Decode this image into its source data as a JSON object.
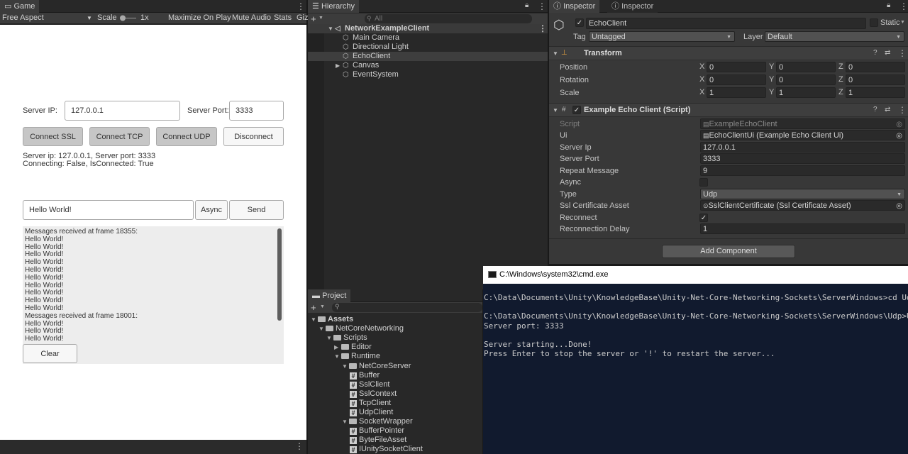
{
  "game": {
    "tab": "Game",
    "toolbar": {
      "aspect": "Free Aspect",
      "scale_label": "Scale",
      "scale_value": "1x",
      "maximize": "Maximize On Play",
      "mute": "Mute Audio",
      "stats": "Stats",
      "gizmos": "Giz"
    },
    "server_ip_label": "Server IP:",
    "server_ip_value": "127.0.0.1",
    "server_port_label": "Server Port:",
    "server_port_value": "3333",
    "buttons": {
      "connect_ssl": "Connect SSL",
      "connect_tcp": "Connect TCP",
      "connect_udp": "Connect UDP",
      "disconnect": "Disconnect",
      "async": "Async",
      "send": "Send",
      "clear": "Clear"
    },
    "status_line1": "Server ip: 127.0.0.1, Server port: 3333",
    "status_line2": "Connecting: False, IsConnected: True",
    "message_input": "Hello World!",
    "log": [
      "Messages received at frame 18355:",
      "Hello World!",
      "Hello World!",
      "Hello World!",
      "Hello World!",
      "Hello World!",
      "Hello World!",
      "Hello World!",
      "Hello World!",
      "Hello World!",
      "Hello World!",
      "Messages received at frame 18001:",
      "Hello World!",
      "Hello World!",
      "Hello World!"
    ]
  },
  "hierarchy": {
    "tab": "Hierarchy",
    "search_placeholder": "All",
    "scene": "NetworkExampleClient",
    "items": [
      "Main Camera",
      "Directional Light",
      "EchoClient",
      "Canvas",
      "EventSystem"
    ]
  },
  "project": {
    "tab": "Project",
    "tree": [
      {
        "label": "Assets",
        "depth": 0,
        "kind": "folder",
        "bold": true
      },
      {
        "label": "NetCoreNetworking",
        "depth": 1,
        "kind": "folder"
      },
      {
        "label": "Scripts",
        "depth": 2,
        "kind": "folder"
      },
      {
        "label": "Editor",
        "depth": 3,
        "kind": "folder",
        "collapsed": true
      },
      {
        "label": "Runtime",
        "depth": 3,
        "kind": "folder"
      },
      {
        "label": "NetCoreServer",
        "depth": 4,
        "kind": "folder"
      },
      {
        "label": "Buffer",
        "depth": 5,
        "kind": "script"
      },
      {
        "label": "SslClient",
        "depth": 5,
        "kind": "script"
      },
      {
        "label": "SslContext",
        "depth": 5,
        "kind": "script"
      },
      {
        "label": "TcpClient",
        "depth": 5,
        "kind": "script"
      },
      {
        "label": "UdpClient",
        "depth": 5,
        "kind": "script"
      },
      {
        "label": "SocketWrapper",
        "depth": 4,
        "kind": "folder"
      },
      {
        "label": "BufferPointer",
        "depth": 5,
        "kind": "script"
      },
      {
        "label": "ByteFileAsset",
        "depth": 5,
        "kind": "script"
      },
      {
        "label": "IUnitySocketClient",
        "depth": 5,
        "kind": "script"
      }
    ]
  },
  "inspector": {
    "tabs": [
      "Inspector",
      "Inspector"
    ],
    "object_name": "EchoClient",
    "static_label": "Static",
    "tag_label": "Tag",
    "tag_value": "Untagged",
    "layer_label": "Layer",
    "layer_value": "Default",
    "transform": {
      "title": "Transform",
      "rows": [
        {
          "label": "Position",
          "x": "0",
          "y": "0",
          "z": "0"
        },
        {
          "label": "Rotation",
          "x": "0",
          "y": "0",
          "z": "0"
        },
        {
          "label": "Scale",
          "x": "1",
          "y": "1",
          "z": "1"
        }
      ]
    },
    "script": {
      "title": "Example Echo Client (Script)",
      "script_label": "Script",
      "script_value": "ExampleEchoClient",
      "ui_label": "Ui",
      "ui_value": "EchoClientUi (Example Echo Client Ui)",
      "server_ip_label": "Server Ip",
      "server_ip_value": "127.0.0.1",
      "server_port_label": "Server Port",
      "server_port_value": "3333",
      "repeat_label": "Repeat Message",
      "repeat_value": "9",
      "async_label": "Async",
      "type_label": "Type",
      "type_value": "Udp",
      "ssl_label": "Ssl Certificate Asset",
      "ssl_value": "SslClientCertificate (Ssl Certificate Asset)",
      "reconnect_label": "Reconnect",
      "delay_label": "Reconnection Delay",
      "delay_value": "1"
    },
    "add_component": "Add Component"
  },
  "cmd": {
    "title": "C:\\Windows\\system32\\cmd.exe",
    "lines": [
      "C:\\Data\\Documents\\Unity\\KnowledgeBase\\Unity-Net-Core-Networking-Sockets\\ServerWindows>cd Udp",
      "",
      "C:\\Data\\Documents\\Unity\\KnowledgeBase\\Unity-Net-Core-Networking-Sockets\\ServerWindows\\Udp>UdpEchoS",
      "Server port: 3333",
      "",
      "Server starting...Done!",
      "Press Enter to stop the server or '!' to restart the server..."
    ]
  }
}
